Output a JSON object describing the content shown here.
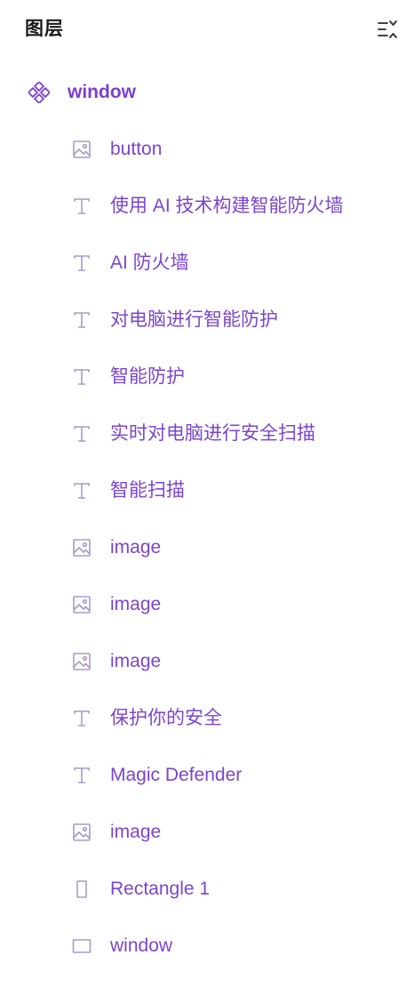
{
  "panel": {
    "title": "图层"
  },
  "colors": {
    "accent": "#7b45cf",
    "icon": "#a89bc9",
    "title": "#1b1b1f"
  },
  "tree": {
    "root": {
      "label": "window",
      "icon": "component-icon"
    },
    "children": [
      {
        "label": "button",
        "icon": "image-icon"
      },
      {
        "label": "使用 AI 技术构建智能防火墙",
        "icon": "text-icon"
      },
      {
        "label": "AI 防火墙",
        "icon": "text-icon"
      },
      {
        "label": "对电脑进行智能防护",
        "icon": "text-icon"
      },
      {
        "label": "智能防护",
        "icon": "text-icon"
      },
      {
        "label": "实时对电脑进行安全扫描",
        "icon": "text-icon"
      },
      {
        "label": "智能扫描",
        "icon": "text-icon"
      },
      {
        "label": "image",
        "icon": "image-icon"
      },
      {
        "label": "image",
        "icon": "image-icon"
      },
      {
        "label": "image",
        "icon": "image-icon"
      },
      {
        "label": "保护你的安全",
        "icon": "text-icon"
      },
      {
        "label": "Magic Defender",
        "icon": "text-icon"
      },
      {
        "label": "image",
        "icon": "image-icon"
      },
      {
        "label": "Rectangle 1",
        "icon": "rectangle-tall-icon"
      },
      {
        "label": "window",
        "icon": "rectangle-wide-icon"
      }
    ]
  }
}
